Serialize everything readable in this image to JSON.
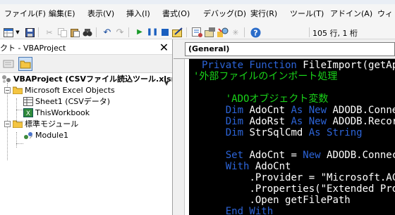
{
  "menu": {
    "items": [
      "ファイル(F)",
      "編集(E)",
      "表示(V)",
      "挿入(I)",
      "書式(O)",
      "デバッグ(D)",
      "実行(R)",
      "ツール(T)",
      "アドイン(A)",
      "ウィ"
    ]
  },
  "toolbar": {
    "status": "105 行, 1 桁"
  },
  "project": {
    "title": "クト - VBAProject",
    "close": "✕",
    "tree": {
      "root": "VBAProject (CSVファイル読込ツール.xlsm",
      "excel_objects": "Microsoft Excel Objects",
      "sheet1": "Sheet1 (CSVデータ)",
      "thisworkbook": "ThisWorkbook",
      "modules": "標準モジュール",
      "module1": "Module1"
    }
  },
  "code": {
    "object_combo": "(General)",
    "lines": [
      [
        "Private Function ",
        "FileImport(getApp",
        ""
      ],
      [
        "",
        "",
        "'外部ファイルのインポート処理"
      ],
      [
        "",
        "",
        ""
      ],
      [
        "",
        "",
        "    'ADOオブジェクト変数"
      ],
      [
        "    Dim ",
        "AdoCnt ",
        ""
      ],
      [
        "    Dim ",
        "AdoRst ",
        ""
      ],
      [
        "    Dim ",
        "StrSqlCmd ",
        ""
      ],
      [
        "",
        "",
        ""
      ],
      [
        "    Set ",
        "AdoCnt ",
        ""
      ],
      [
        "    With ",
        "AdoCnt",
        ""
      ],
      [
        "",
        "        .Provider = \"Microsoft.ACE",
        ""
      ],
      [
        "",
        "        .Properties(\"Extended Prope",
        ""
      ],
      [
        "",
        "        .Open getFilePath",
        ""
      ],
      [
        "    End With",
        "",
        ""
      ]
    ],
    "line1_kw": "Private Function ",
    "line1_id": "FileImport(getApp",
    "line2_cm": "'外部ファイルのインポート処理",
    "line4_cm": "'ADOオブジェクト変数",
    "line5": {
      "kw1": "Dim ",
      "id1": "AdoCnt ",
      "kw2": "As New ",
      "id2": "ADODB.Connect"
    },
    "line6": {
      "kw1": "Dim ",
      "id1": "AdoRst ",
      "kw2": "As New ",
      "id2": "ADODB.Records"
    },
    "line7": {
      "kw1": "Dim ",
      "id1": "StrSqlCmd ",
      "kw2": "As String"
    },
    "line9": {
      "kw1": "Set ",
      "id1": "AdoCnt = ",
      "kw2": "New ",
      "id2": "ADODB.Connect"
    },
    "line10": {
      "kw1": "With ",
      "id1": "AdoCnt"
    },
    "line11": ".Provider = \"Microsoft.ACE",
    "line12": ".Properties(\"Extended Prope",
    "line13": ".Open getFilePath",
    "line14": "End With"
  }
}
